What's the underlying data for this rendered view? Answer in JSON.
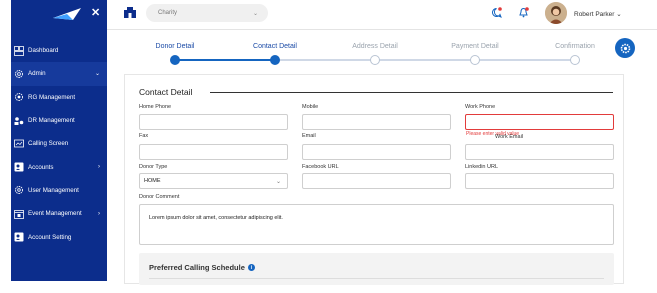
{
  "sidebar": {
    "items": [
      {
        "label": "Dashboard",
        "icon": "dashboard-icon",
        "chevron": ""
      },
      {
        "label": "Admin",
        "icon": "admin-gear-icon",
        "chevron": "⌄"
      },
      {
        "label": "RG Management",
        "icon": "rg-management-icon",
        "chevron": ""
      },
      {
        "label": "DR Management",
        "icon": "dr-management-icon",
        "chevron": ""
      },
      {
        "label": "Calling Screen",
        "icon": "calling-screen-icon",
        "chevron": ""
      },
      {
        "label": "Accounts",
        "icon": "accounts-icon",
        "chevron": "›"
      },
      {
        "label": "User Management",
        "icon": "user-management-icon",
        "chevron": ""
      },
      {
        "label": "Event Management",
        "icon": "event-management-icon",
        "chevron": "›"
      },
      {
        "label": "Account Setting",
        "icon": "account-setting-icon",
        "chevron": ""
      }
    ],
    "active_index": 1,
    "close_glyph": "✕"
  },
  "topbar": {
    "org_select_value": "Charity",
    "user_name": "Robert Parker",
    "user_menu_chevron": "⌄"
  },
  "stepper": {
    "steps": [
      "Donor Detail",
      "Contact Detail",
      "Address Detail",
      "Payment Detail",
      "Confirmation"
    ],
    "completed_count": 2
  },
  "form": {
    "title": "Contact Detail",
    "home_phone_label": "Home Phone",
    "home_phone_value": "",
    "mobile_label": "Mobile",
    "mobile_value": "",
    "work_phone_label": "Work Phone",
    "work_phone_value": "",
    "work_phone_error": "Please enter valid value",
    "fax_label": "Fax",
    "fax_value": "",
    "email_label": "Email",
    "email_value": "",
    "work_email_label": "Work Email",
    "work_email_value": "",
    "donor_type_label": "Donor Type",
    "donor_type_value": "HOME",
    "facebook_label": "Facebook URL",
    "facebook_value": "",
    "linkedin_label": "Linkedin URL",
    "linkedin_value": "",
    "donor_comment_label": "Donor Comment",
    "donor_comment_value": "Lorem ipsum dolor sit amet, consectetur adipiscing elit.",
    "preferred_schedule_title": "Preferred Calling Schedule",
    "info_glyph": "i"
  },
  "colors": {
    "sidebar_bg": "#0c2d8c",
    "accent": "#1565c0",
    "error": "#e23b3b"
  }
}
